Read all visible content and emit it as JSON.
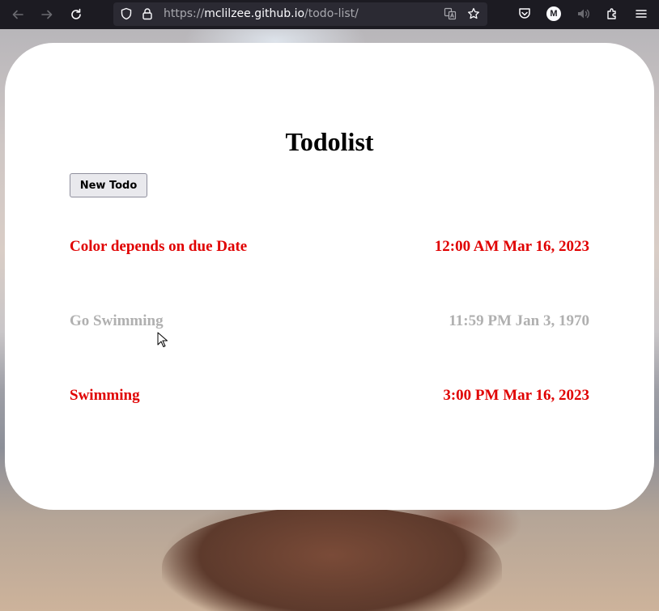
{
  "browser": {
    "url_prefix": "https://",
    "url_host": "mclilzee.github.io",
    "url_path": "/todo-list/",
    "icons": [
      "back-icon",
      "forward-icon",
      "reload-icon",
      "shield-icon",
      "lock-icon",
      "translate-icon",
      "bookmark-star-icon",
      "pocket-icon",
      "account-icon",
      "speaker-icon",
      "extensions-icon",
      "menu-icon"
    ],
    "account_initial": "M"
  },
  "page": {
    "title": "Todolist",
    "new_todo_label": "New Todo",
    "todos": [
      {
        "name": "Color depends on due Date",
        "due": "12:00 AM Mar 16, 2023",
        "color": "#e00000"
      },
      {
        "name": "Go Swimming",
        "due": "11:59 PM Jan 3, 1970",
        "color": "#b0b0b0"
      },
      {
        "name": "Swimming",
        "due": "3:00 PM Mar 16, 2023",
        "color": "#e00000"
      }
    ]
  },
  "colors": {
    "toolbar_bg": "#1c1b22",
    "urlbar_bg": "#2b2a33",
    "overdue_red": "#e00000",
    "completed_gray": "#b0b0b0"
  }
}
